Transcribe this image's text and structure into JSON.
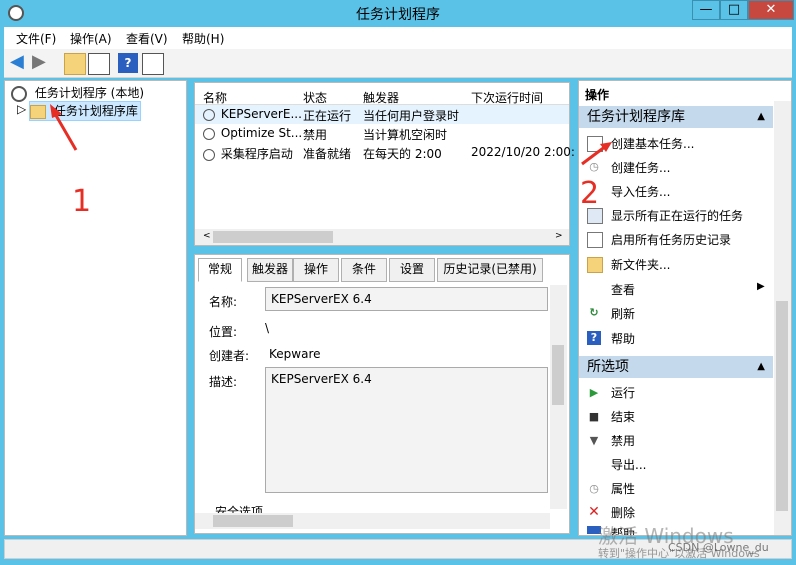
{
  "window": {
    "title": "任务计划程序",
    "controls": [
      "—",
      "□",
      "✕"
    ]
  },
  "menu": [
    "文件(F)",
    "操作(A)",
    "查看(V)",
    "帮助(H)"
  ],
  "tree": {
    "root": "任务计划程序 (本地)",
    "child": "任务计划程序库"
  },
  "task_table": {
    "columns": [
      "名称",
      "状态",
      "触发器",
      "下次运行时间"
    ],
    "rows": [
      {
        "name": "KEPServerE...",
        "status": "正在运行",
        "trigger": "当任何用户登录时",
        "next": ""
      },
      {
        "name": "Optimize St...",
        "status": "禁用",
        "trigger": "当计算机空闲时",
        "next": ""
      },
      {
        "name": "采集程序启动",
        "status": "准备就绪",
        "trigger": "在每天的 2:00",
        "next": "2022/10/20 2:00:"
      }
    ]
  },
  "detail_tabs": [
    "常规",
    "触发器",
    "操作",
    "条件",
    "设置",
    "历史记录(已禁用)"
  ],
  "detail": {
    "name_label": "名称:",
    "name_value": "KEPServerEX 6.4",
    "location_label": "位置:",
    "location_value": "\\",
    "author_label": "创建者:",
    "author_value": "Kepware",
    "desc_label": "描述:",
    "desc_value": "KEPServerEX 6.4",
    "security_label": "安全选项"
  },
  "actions": {
    "header": "操作",
    "section1": "任务计划程序库",
    "items1": [
      "创建基本任务...",
      "创建任务...",
      "导入任务...",
      "显示所有正在运行的任务",
      "启用所有任务历史记录",
      "新文件夹...",
      "查看",
      "刷新",
      "帮助"
    ],
    "section2": "所选项",
    "items2": [
      "运行",
      "结束",
      "禁用",
      "导出...",
      "属性",
      "删除",
      "帮助"
    ]
  },
  "annotations": {
    "one": "1",
    "two": "2"
  },
  "watermark": {
    "line1": "激活 Windows",
    "line2": "转到\"操作中心\"以激活 Windows",
    "csdn": "CSDN @Lowne_du"
  }
}
